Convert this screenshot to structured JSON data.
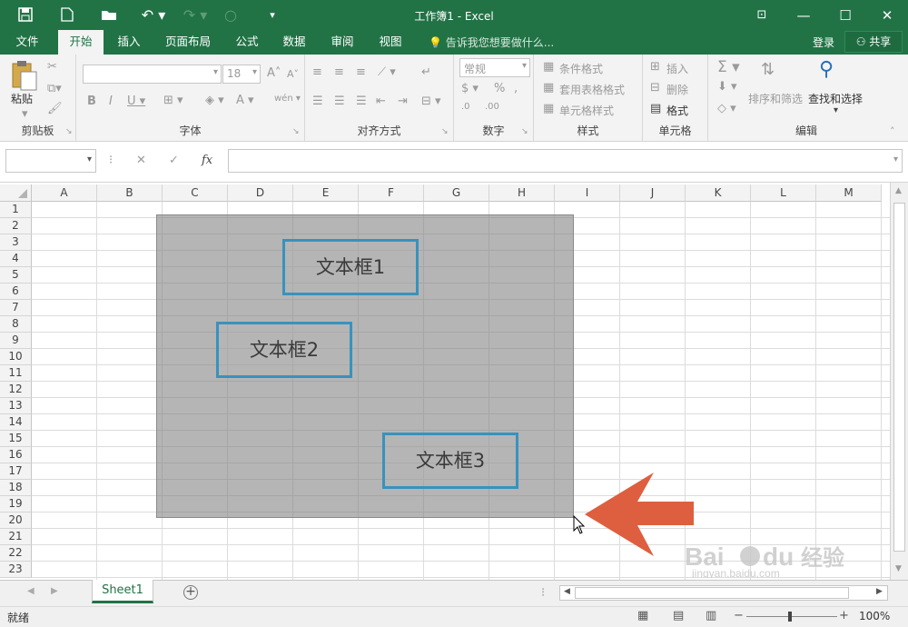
{
  "title": "工作簿1 - Excel",
  "tabs": [
    "文件",
    "开始",
    "插入",
    "页面布局",
    "公式",
    "数据",
    "审阅",
    "视图"
  ],
  "tell_me": "告诉我您想要做什么...",
  "login": "登录",
  "share": "共享",
  "ribbon": {
    "clipboard": {
      "label": "剪贴板",
      "paste": "粘贴"
    },
    "font": {
      "label": "字体",
      "size": "18"
    },
    "alignment": {
      "label": "对齐方式"
    },
    "number": {
      "label": "数字",
      "format": "常规"
    },
    "styles": {
      "label": "样式",
      "items": [
        "条件格式",
        "套用表格格式",
        "单元格样式"
      ]
    },
    "cells": {
      "label": "单元格",
      "items": [
        "插入",
        "删除",
        "格式"
      ]
    },
    "editing": {
      "label": "编辑",
      "sort": "排序和筛选",
      "find": "查找和选择"
    }
  },
  "formula_bar": {
    "fx": "fx",
    "value": ""
  },
  "columns": [
    "A",
    "B",
    "C",
    "D",
    "E",
    "F",
    "G",
    "H",
    "I",
    "J",
    "K",
    "L",
    "M"
  ],
  "rows": [
    "1",
    "2",
    "3",
    "4",
    "5",
    "6",
    "7",
    "8",
    "9",
    "10",
    "11",
    "12",
    "13",
    "14",
    "15",
    "16",
    "17",
    "18",
    "19",
    "20",
    "21",
    "22",
    "23"
  ],
  "textboxes": [
    "文本框1",
    "文本框2",
    "文本框3"
  ],
  "sheet_tab": "Sheet1",
  "status": "就绪",
  "zoom": "100%",
  "watermark": "Baidu经验 jingyan.baidu.com",
  "colors": {
    "excel_green": "#217346",
    "textbox_border": "#3892bd",
    "arrow": "#dd5f3f"
  }
}
